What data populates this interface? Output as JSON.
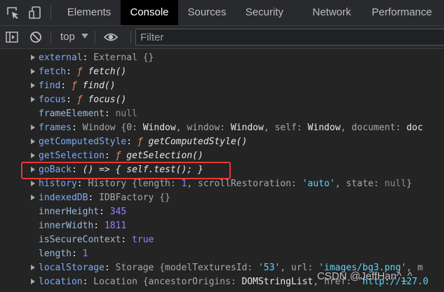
{
  "tabs": [
    "Elements",
    "Console",
    "Sources",
    "Security",
    "Network",
    "Performance"
  ],
  "toolbar": {
    "context": "top",
    "filter_placeholder": "Filter"
  },
  "watermark": "CSDN @JeffHan^_^",
  "rows": {
    "external": {
      "key": "external",
      "val": "External {}"
    },
    "fetch": {
      "key": "fetch",
      "f": "ƒ",
      "val": "fetch()"
    },
    "find": {
      "key": "find",
      "f": "ƒ",
      "val": "find()"
    },
    "focus": {
      "key": "focus",
      "f": "ƒ",
      "val": "focus()"
    },
    "frameElement": {
      "key": "frameElement",
      "val": "null"
    },
    "frames": {
      "key": "frames",
      "t1": "Window {0: ",
      "v1": "Window",
      "t2": ", window: ",
      "v2": "Window",
      "t3": ", self: ",
      "v3": "Window",
      "t4": ", document: ",
      "v4": "doc"
    },
    "getComputedStyle": {
      "key": "getComputedStyle",
      "f": "ƒ",
      "val": "getComputedStyle()"
    },
    "getSelection": {
      "key": "getSelection",
      "f": "ƒ",
      "val": "getSelection()"
    },
    "goBack": {
      "key": "goBack",
      "val": "() => { self.test(); }"
    },
    "history": {
      "key": "history",
      "t1": "History {length: ",
      "n1": "1",
      "t2": ", scrollRestoration: ",
      "s1": "'auto'",
      "t3": ", state: ",
      "v1": "null",
      "t4": "}"
    },
    "indexedDB": {
      "key": "indexedDB",
      "val": "IDBFactory {}"
    },
    "innerHeight": {
      "key": "innerHeight",
      "val": "345"
    },
    "innerWidth": {
      "key": "innerWidth",
      "val": "1811"
    },
    "isSecureContext": {
      "key": "isSecureContext",
      "val": "true"
    },
    "length": {
      "key": "length",
      "val": "1"
    },
    "localStorage": {
      "key": "localStorage",
      "t1": "Storage {modelTexturesId: ",
      "s1": "'53'",
      "t2": ", url: ",
      "s2": "'images/bg3.png'",
      "t3": ", m"
    },
    "location": {
      "key": "location",
      "t1": "Location {ancestorOrigins: ",
      "v1": "DOMStringList",
      "t2": ", href: ",
      "s1": "'http://127.0"
    }
  },
  "colors": {
    "highlight": "#e53935",
    "key": "#7cacf8",
    "function": "#f28b54",
    "string": "#5cd5fb",
    "number": "#9980ff"
  }
}
